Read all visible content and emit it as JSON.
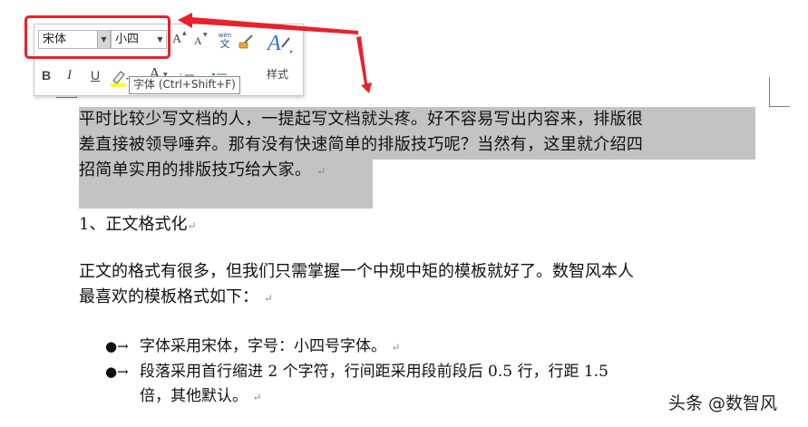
{
  "toolbar": {
    "font_name": "宋体",
    "font_size": "小四",
    "grow_font": "A",
    "shrink_font": "A",
    "phonetic_top": "wén",
    "phonetic_bottom": "文",
    "bold": "B",
    "italic": "I",
    "underline": "U",
    "font_color": "A",
    "styles_label": "样式",
    "tooltip": "字体 (Ctrl+Shift+F)"
  },
  "document": {
    "intro_lines": [
      "平时比较少写文档的人，一提起写文档就头疼。好不容易写出内容来，排版很",
      "差直接被领导唾弃。那有没有快速简单的排版技巧呢？当然有，这里就介绍四",
      "招简单实用的排版技巧给大家。"
    ],
    "heading": "1、正文格式化",
    "para2_lines": [
      "正文的格式有很多，但我们只需掌握一个中规中矩的模板就好了。数智风本人",
      "最喜欢的模板格式如下："
    ],
    "bullets": [
      {
        "lines": [
          "字体采用宋体，字号：小四号字体。"
        ]
      },
      {
        "lines": [
          "段落采用首行缩进 2 个字符，行间距采用段前段后 0.5 行，行距 1.5",
          "倍，其他默认。"
        ]
      }
    ],
    "paragraph_mark": "↵"
  },
  "watermark": "头条 @数智风",
  "colors": {
    "highlight_box": "#e8212b",
    "selection": "#c3c3c3",
    "highlighter_yellow": "#ffff00",
    "font_color_red": "#ff0000"
  }
}
